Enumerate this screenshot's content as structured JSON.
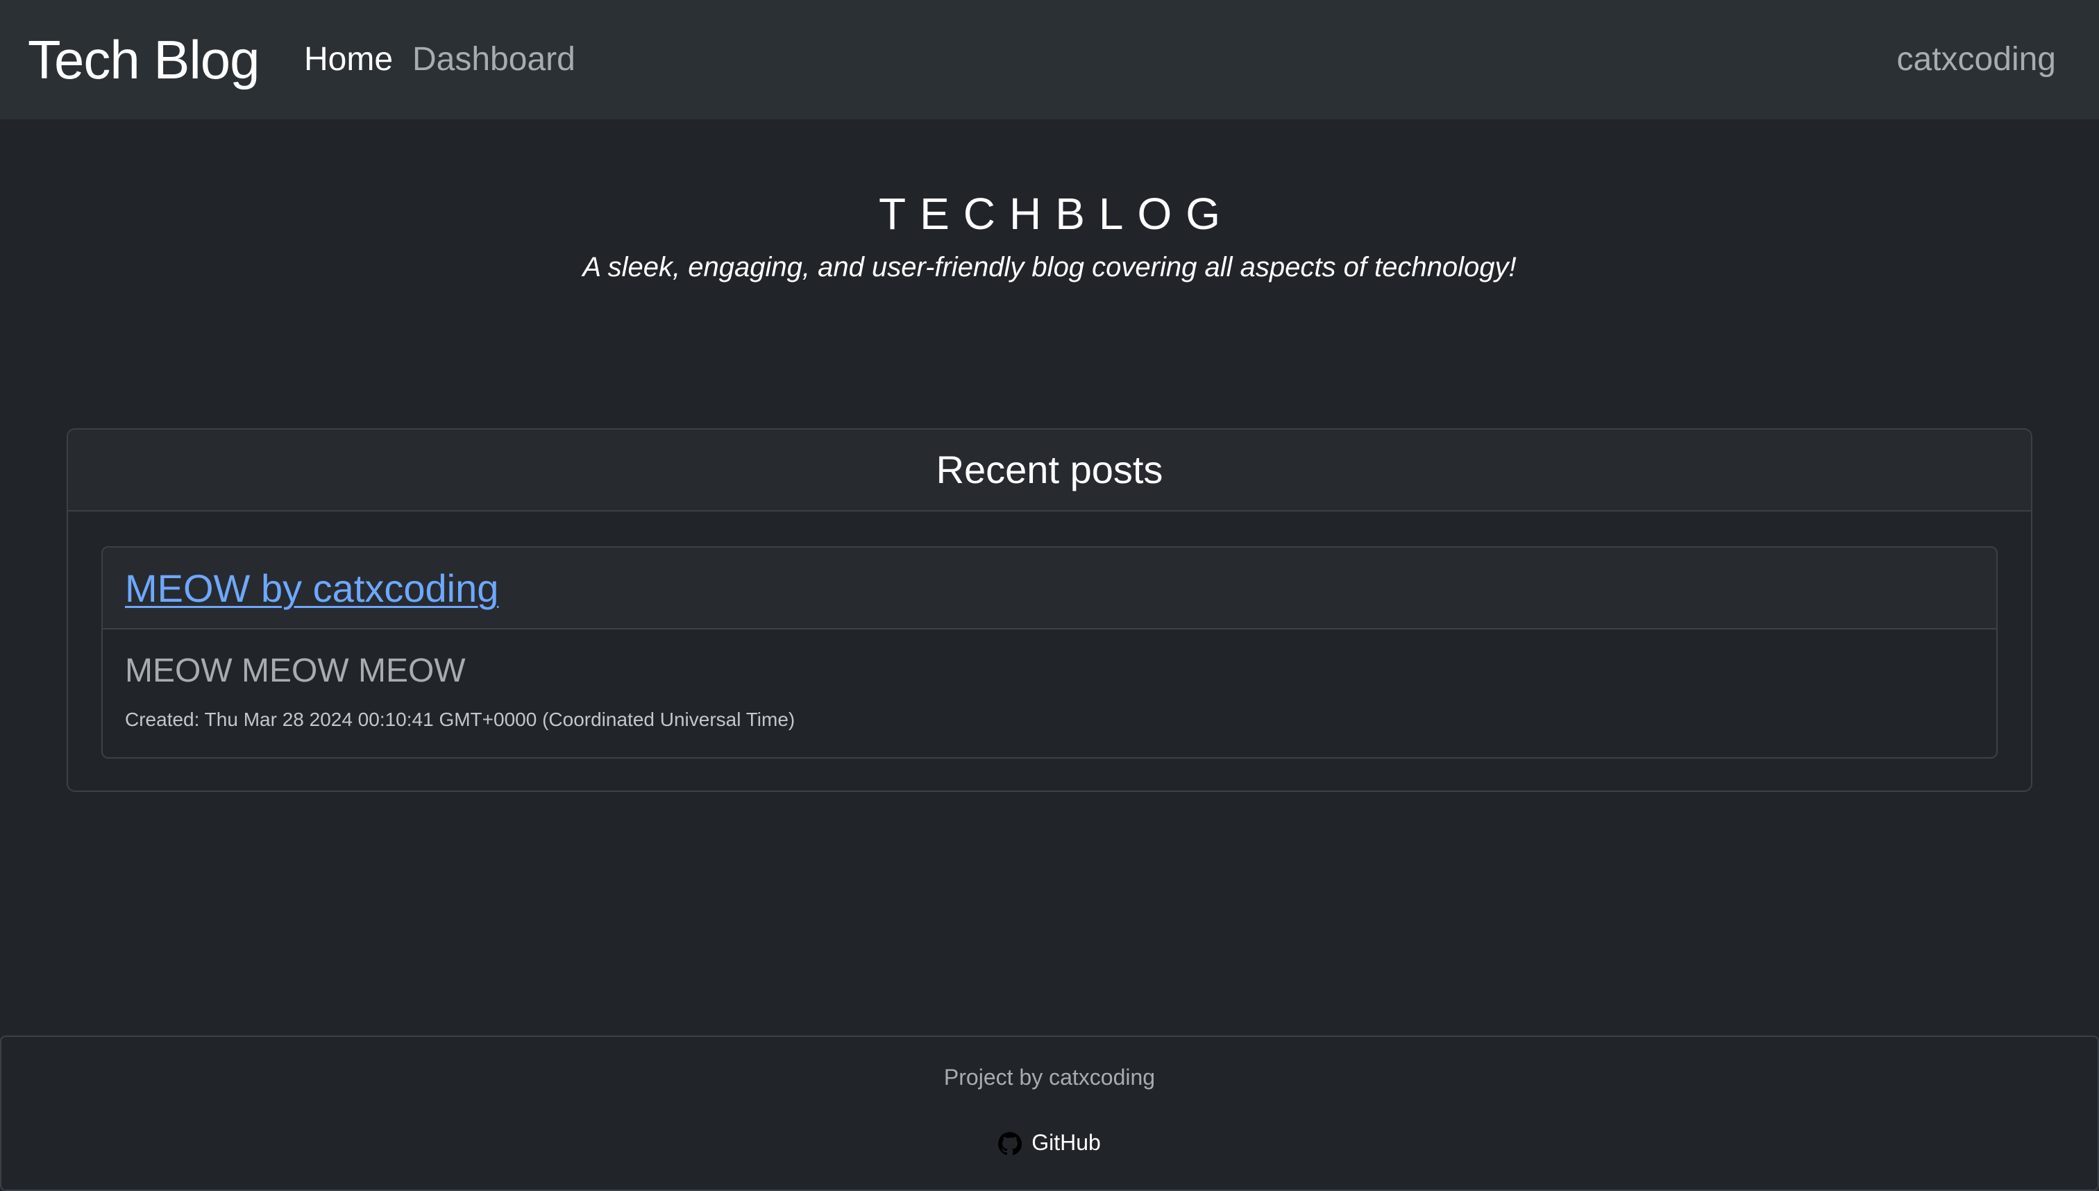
{
  "navbar": {
    "brand": "Tech Blog",
    "links": [
      {
        "label": "Home",
        "active": true
      },
      {
        "label": "Dashboard",
        "active": false
      }
    ],
    "user": "catxcoding"
  },
  "hero": {
    "title": "TECHBLOG",
    "subtitle": "A sleek, engaging, and user-friendly blog covering all aspects of technology!"
  },
  "recent_posts": {
    "heading": "Recent posts",
    "posts": [
      {
        "title": "MEOW by catxcoding",
        "content": "MEOW MEOW MEOW",
        "created": "Created: Thu Mar 28 2024 00:10:41 GMT+0000 (Coordinated Universal Time)"
      }
    ]
  },
  "footer": {
    "credit": "Project by catxcoding",
    "github_label": "GitHub",
    "github_icon": "github-icon"
  },
  "colors": {
    "background": "#212529",
    "navbar": "#2b3035",
    "link": "#6ea8fe",
    "border": "#3c4147"
  }
}
